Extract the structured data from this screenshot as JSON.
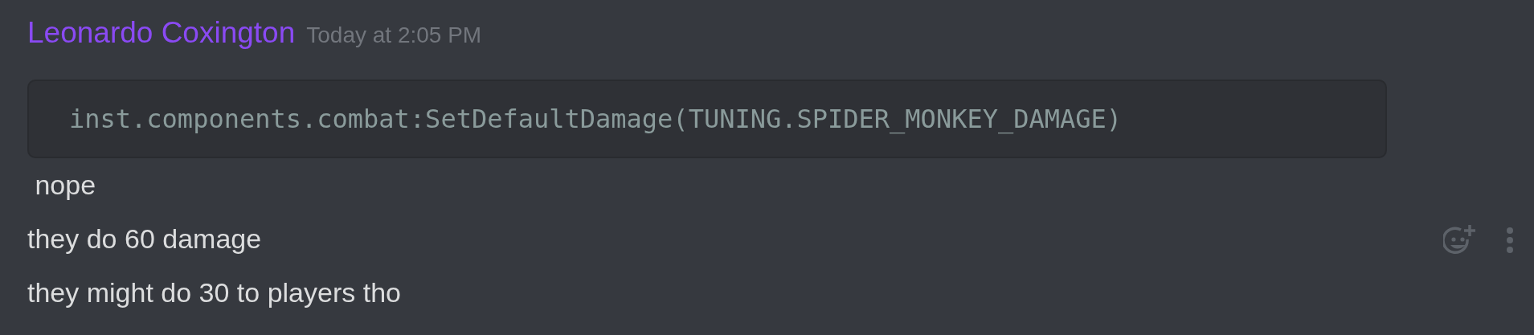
{
  "author": {
    "name": "Leonardo Coxington",
    "color": "#8a4af3"
  },
  "timestamp": "Today at 2:05 PM",
  "messages": [
    {
      "kind": "code",
      "text": "inst.components.combat:SetDefaultDamage(TUNING.SPIDER_MONKEY_DAMAGE)"
    },
    {
      "kind": "text",
      "text": " nope"
    },
    {
      "kind": "text",
      "text": "they do 60 damage",
      "hovered": true
    },
    {
      "kind": "text",
      "text": "they might do 30 to players tho"
    }
  ]
}
